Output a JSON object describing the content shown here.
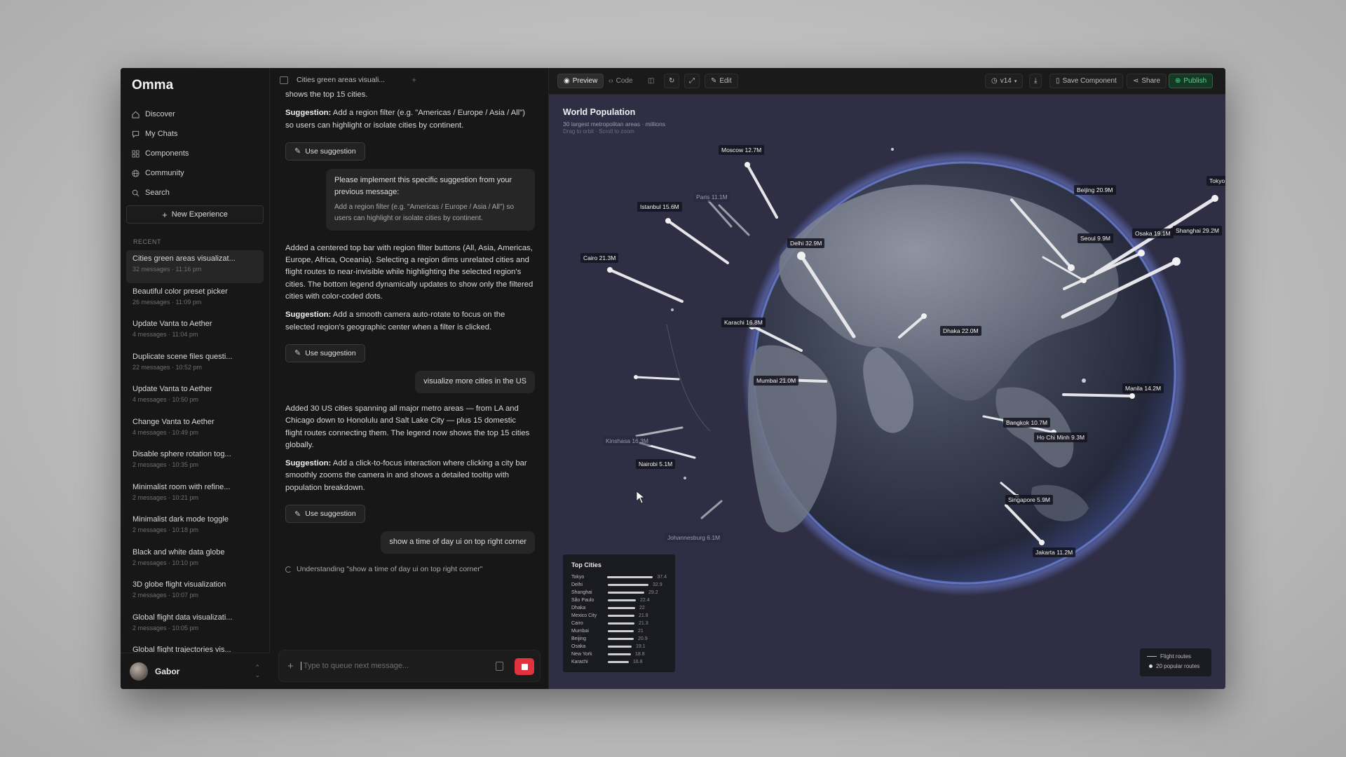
{
  "app": {
    "brand": "Omma"
  },
  "nav": [
    {
      "label": "Discover",
      "icon": "home-icon"
    },
    {
      "label": "My Chats",
      "icon": "chat-icon"
    },
    {
      "label": "Components",
      "icon": "grid-icon"
    },
    {
      "label": "Community",
      "icon": "globe-icon"
    },
    {
      "label": "Search",
      "icon": "search-icon"
    }
  ],
  "new_experience_label": "New Experience",
  "recent_label": "RECENT",
  "recent": [
    {
      "title": "Cities green areas visualizat...",
      "meta": "32 messages · 11:16 pm"
    },
    {
      "title": "Beautiful color preset picker",
      "meta": "26 messages · 11:09 pm"
    },
    {
      "title": "Update Vanta to Aether",
      "meta": "4 messages · 11:04 pm"
    },
    {
      "title": "Duplicate scene files questi...",
      "meta": "22 messages · 10:52 pm"
    },
    {
      "title": "Update Vanta to Aether",
      "meta": "4 messages · 10:50 pm"
    },
    {
      "title": "Change Vanta to Aether",
      "meta": "4 messages · 10:49 pm"
    },
    {
      "title": "Disable sphere rotation tog...",
      "meta": "2 messages · 10:35 pm"
    },
    {
      "title": "Minimalist room with refine...",
      "meta": "2 messages · 10:21 pm"
    },
    {
      "title": "Minimalist dark mode toggle",
      "meta": "2 messages · 10:18 pm"
    },
    {
      "title": "Black and white data globe",
      "meta": "2 messages · 10:10 pm"
    },
    {
      "title": "3D globe flight visualization",
      "meta": "2 messages · 10:07 pm"
    },
    {
      "title": "Global flight data visualizati...",
      "meta": "2 messages · 10:05 pm"
    },
    {
      "title": "Global flight trajectories vis...",
      "meta": ""
    }
  ],
  "user": {
    "name": "Gabor"
  },
  "chat": {
    "tab_title": "Cities green areas visuali...",
    "top_text": "shows the top 15 cities.",
    "sug1_label": "Suggestion:",
    "sug1_text": " Add a region filter (e.g. \"Americas / Europe / Asia / All\") so users can highlight or isolate cities by continent.",
    "use_suggestion": "Use suggestion",
    "user1_main": "Please implement this specific suggestion from your previous message:",
    "user1_quote": "Add a region filter (e.g. \"Americas / Europe / Asia / All\") so users can highlight or isolate cities by continent.",
    "ai2_text": "Added a centered top bar with region filter buttons (All, Asia, Americas, Europe, Africa, Oceania). Selecting a region dims unrelated cities and flight routes to near-invisible while highlighting the selected region's cities. The bottom legend dynamically updates to show only the filtered cities with color-coded dots.",
    "sug2_label": "Suggestion:",
    "sug2_text": " Add a smooth camera auto-rotate to focus on the selected region's geographic center when a filter is clicked.",
    "user2": "visualize more cities in the US",
    "ai3_text": "Added 30 US cities spanning all major metro areas — from LA and Chicago down to Honolulu and Salt Lake City — plus 15 domestic flight routes connecting them. The legend now shows the top 15 cities globally.",
    "sug3_label": "Suggestion:",
    "sug3_text": " Add a click-to-focus interaction where clicking a city bar smoothly zooms the camera in and shows a detailed tooltip with population breakdown.",
    "user3": "show a time of day ui on top right corner",
    "status": "Understanding \"show a time of day ui on top right corner\"",
    "composer_placeholder": "Type to queue next message..."
  },
  "toolbar": {
    "preview": "Preview",
    "code": "Code",
    "edit": "Edit",
    "version": "v14",
    "save": "Save Component",
    "share": "Share",
    "publish": "Publish"
  },
  "viz": {
    "title": "World Population",
    "subtitle": "30 largest metropolitan areas · millions",
    "hint": "Drag to orbit · Scroll to zoom",
    "labels": [
      {
        "text": "Moscow 12.7M",
        "dim": false
      },
      {
        "text": "Istanbul 15.6M",
        "dim": false
      },
      {
        "text": "Paris 11.1M",
        "dim": true
      },
      {
        "text": "Cairo 21.3M",
        "dim": false
      },
      {
        "text": "Delhi 32.9M",
        "dim": false
      },
      {
        "text": "Karachi 16.8M",
        "dim": false
      },
      {
        "text": "Dhaka 22.0M",
        "dim": false
      },
      {
        "text": "Mumbai 21.0M",
        "dim": false
      },
      {
        "text": "Beijing 20.9M",
        "dim": false
      },
      {
        "text": "Seoul 9.9M",
        "dim": false
      },
      {
        "text": "Osaka 19.1M",
        "dim": false
      },
      {
        "text": "Shanghai 29.2M",
        "dim": false
      },
      {
        "text": "Tokyo",
        "dim": false
      },
      {
        "text": "Manila 14.2M",
        "dim": false
      },
      {
        "text": "Bangkok 10.7M",
        "dim": false
      },
      {
        "text": "Ho Chi Minh 9.3M",
        "dim": false
      },
      {
        "text": "Kinshasa 16.3M",
        "dim": true
      },
      {
        "text": "Nairobi 5.1M",
        "dim": false
      },
      {
        "text": "Singapore 5.9M",
        "dim": false
      },
      {
        "text": "Johannesburg 6.1M",
        "dim": true
      },
      {
        "text": "Jakarta 11.2M",
        "dim": false
      }
    ],
    "top_cities_title": "Top Cities",
    "top_cities": [
      {
        "name": "Tokyo",
        "value": 37.4
      },
      {
        "name": "Delhi",
        "value": 32.9
      },
      {
        "name": "Shanghai",
        "value": 29.2
      },
      {
        "name": "São Paulo",
        "value": 22.4
      },
      {
        "name": "Dhaka",
        "value": 22
      },
      {
        "name": "Mexico City",
        "value": 21.8
      },
      {
        "name": "Cairo",
        "value": 21.3
      },
      {
        "name": "Mumbai",
        "value": 21
      },
      {
        "name": "Beijing",
        "value": 20.9
      },
      {
        "name": "Osaka",
        "value": 19.1
      },
      {
        "name": "New York",
        "value": 18.8
      },
      {
        "name": "Karachi",
        "value": 16.8
      }
    ],
    "route_legend": {
      "routes": "Flight routes",
      "popular": "20 popular routes"
    }
  }
}
